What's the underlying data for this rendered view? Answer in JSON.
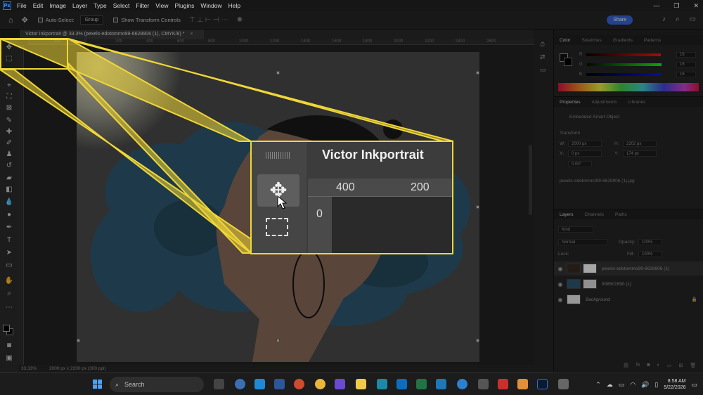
{
  "menubar": {
    "app_logo": "Ps",
    "items": [
      "File",
      "Edit",
      "Image",
      "Layer",
      "Type",
      "Select",
      "Filter",
      "View",
      "Plugins",
      "Window",
      "Help"
    ]
  },
  "options_bar": {
    "auto_select_label": "Auto-Select:",
    "auto_select_value": "Group",
    "show_transform_label": "Show Transform Controls",
    "share_label": "Share"
  },
  "document": {
    "tab_label": "Victor Inkportrait @ 33.3% (pexels-edotommo99-6628906 (1), CMYK/8) *",
    "close_glyph": "×",
    "ruler_marks": [
      "200",
      "0",
      "200",
      "400",
      "600",
      "800",
      "1000",
      "1200",
      "1400",
      "1600",
      "1800",
      "2000",
      "2200",
      "2400",
      "2600"
    ]
  },
  "status_bar": {
    "zoom": "33.33%",
    "doc_info": "2000 px x 2200 px (300 ppi)"
  },
  "callout": {
    "title": "Victor Inkportrait",
    "ruler_label_1": "400",
    "ruler_label_2": "200",
    "vruler_label": "0"
  },
  "color_panel": {
    "tabs": [
      "Color",
      "Swatches",
      "Gradients",
      "Patterns"
    ],
    "rows": [
      {
        "label": "R",
        "value": "16"
      },
      {
        "label": "G",
        "value": "16"
      },
      {
        "label": "B",
        "value": "16"
      }
    ]
  },
  "properties_panel": {
    "tabs": [
      "Properties",
      "Adjustments",
      "Libraries"
    ],
    "object_type": "Embedded Smart Object",
    "section": "Transform",
    "w_label": "W:",
    "w_value": "2000 px",
    "h_label": "H:",
    "h_value": "2202 px",
    "x_label": "X:",
    "x_value": "0 px",
    "y_label": "Y:",
    "y_value": "174 px",
    "angle": "0.00°",
    "file_name": "pexels-edotommo99-6628906 (1).jpg"
  },
  "layers_panel": {
    "tabs": [
      "Layers",
      "Channels",
      "Paths"
    ],
    "kind_label": "Kind",
    "blend_mode": "Normal",
    "opacity_label": "Opacity:",
    "opacity_value": "100%",
    "lock_label": "Lock:",
    "fill_label": "Fill:",
    "fill_value": "100%",
    "layers": [
      {
        "name": "pexels-edotommo99-6628906 (1)",
        "selected": true
      },
      {
        "name": "908501590 (1)",
        "selected": false
      },
      {
        "name": "Background",
        "selected": false
      }
    ]
  },
  "taskbar": {
    "search_placeholder": "Search",
    "time": "8:58 AM",
    "date": "5/22/2026"
  },
  "colors": {
    "callout_yellow": "#f0d736",
    "ink_blue": "#3b6f8c",
    "ps_blue": "#2f6fd6"
  }
}
